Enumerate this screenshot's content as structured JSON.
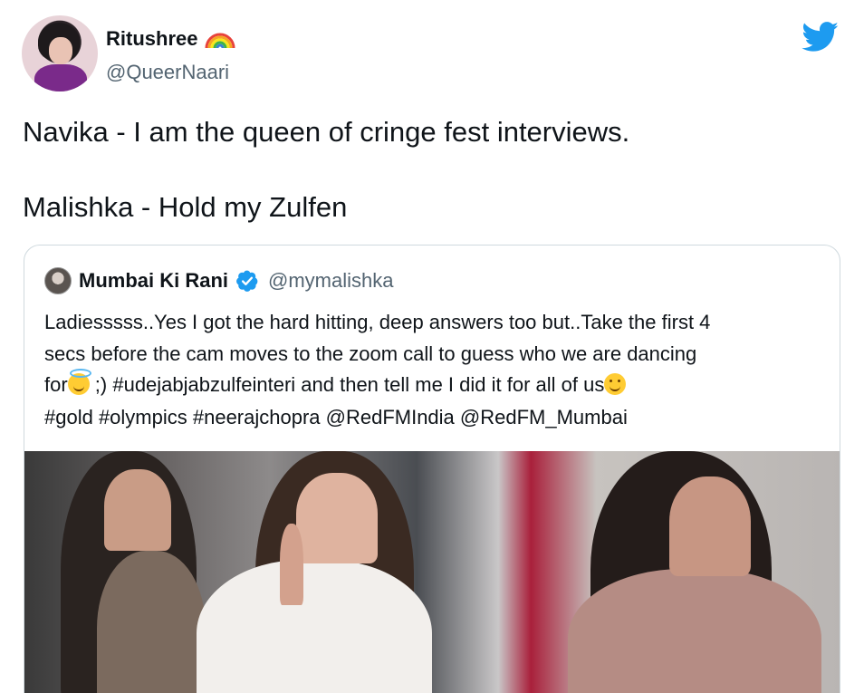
{
  "tweet": {
    "author": {
      "display_name": "Ritushree",
      "handle": "@QueerNaari",
      "name_emoji": "rainbow-icon",
      "avatar": "user-avatar"
    },
    "text_line1": "Navika - I am the queen of cringe fest interviews.",
    "text_line2": "Malishka - Hold my Zulfen",
    "brand_icon": "twitter-bird-icon",
    "colors": {
      "twitter_blue": "#1d9bf0",
      "text_primary": "#0f1419",
      "text_secondary": "#536471",
      "border": "#cfd9de"
    }
  },
  "quote": {
    "author": {
      "display_name": "Mumbai Ki Rani",
      "handle": "@mymalishka",
      "verified_icon": "verified-badge-icon"
    },
    "line1": "Ladiesssss..Yes I got the hard hitting, deep answers too but..Take the first 4",
    "line2": "secs before the cam moves to the zoom call to guess who we are dancing",
    "line3_a": "for",
    "line3_b": " ;) #udejabjabzulfeinteri and then tell me I did it for all of us",
    "line4": "#gold #olympics #neerajchopra @RedFMIndia @RedFM_Mumbai",
    "emoji_1": "smiling-face-with-halo-emoji",
    "emoji_2": "grinning-squinting-face-emoji",
    "media": "video-thumbnail"
  }
}
